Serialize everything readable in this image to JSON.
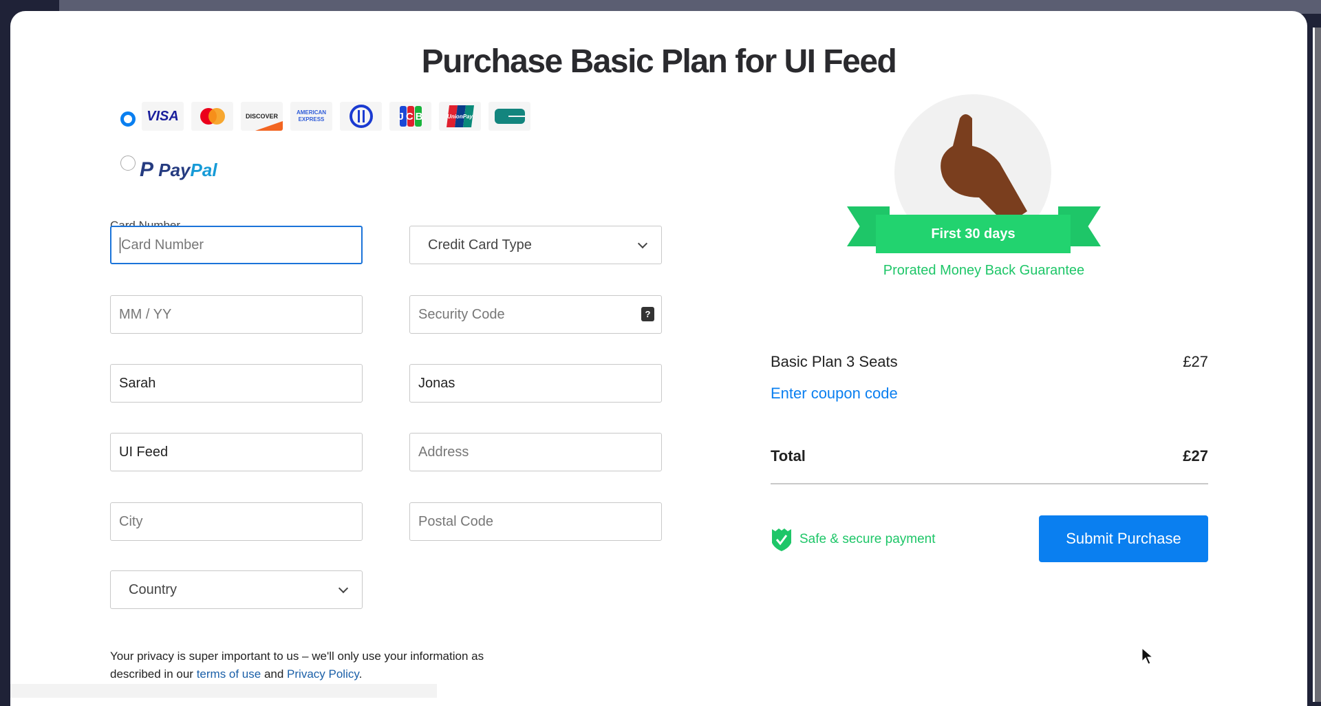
{
  "title": "Purchase Basic Plan for UI Feed",
  "payment_methods": {
    "cards": [
      "VISA",
      "Mastercard",
      "DISCOVER",
      "AMERICAN EXPRESS",
      "Diners Club",
      "JCB",
      "UnionPay",
      "CB"
    ],
    "card_selected": true,
    "paypal_label": [
      "Pay",
      "Pal"
    ],
    "paypal_selected": false
  },
  "form": {
    "card_number_label": "Card Number",
    "card_number_placeholder": "Card Number",
    "card_type": "Credit Card Type",
    "expiry_placeholder": "MM / YY",
    "security_code_placeholder": "Security Code",
    "security_help": "?",
    "first_name": "Sarah",
    "last_name": "Jonas",
    "company": "UI Feed",
    "address_placeholder": "Address",
    "city_placeholder": "City",
    "postal_placeholder": "Postal Code",
    "country": "Country"
  },
  "privacy": {
    "text1": "Your privacy is super important to us – we'll only use your information as described in our ",
    "terms": "terms of use",
    "and": " and ",
    "policy": "Privacy Policy",
    "end": "."
  },
  "guarantee": {
    "ribbon": "First 30 days",
    "caption": "Prorated Money Back Guarantee"
  },
  "summary": {
    "item": "Basic Plan 3 Seats",
    "item_price": "£27",
    "coupon": "Enter coupon code",
    "total_label": "Total",
    "total": "£27",
    "secure": "Safe & secure payment",
    "submit": "Submit Purchase"
  },
  "colors": {
    "accent": "#0a7ff0",
    "green": "#1ec668"
  }
}
